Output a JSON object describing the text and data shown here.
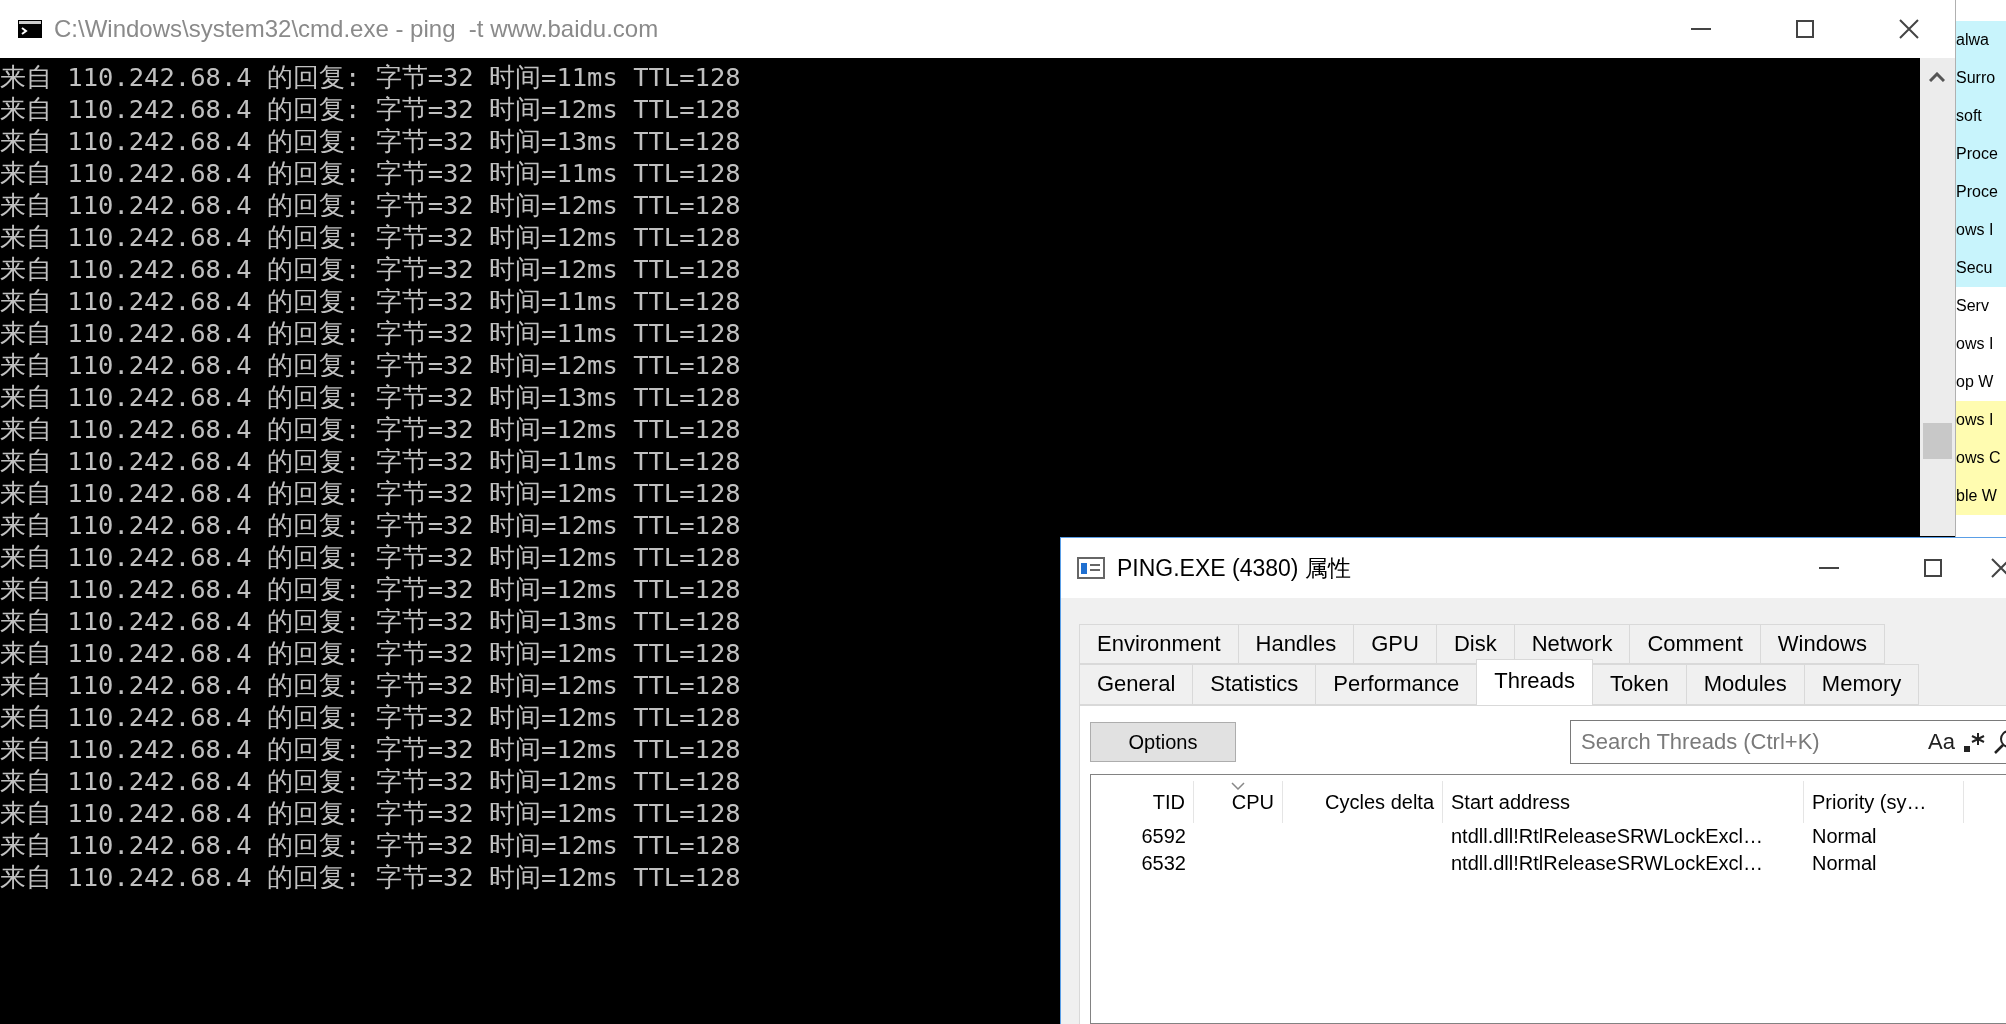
{
  "cmd_window": {
    "title": "C:\\Windows\\system32\\cmd.exe - ping  -t www.baidu.com",
    "lines": [
      "来自 110.242.68.4 的回复: 字节=32 时间=11ms TTL=128",
      "来自 110.242.68.4 的回复: 字节=32 时间=12ms TTL=128",
      "来自 110.242.68.4 的回复: 字节=32 时间=13ms TTL=128",
      "来自 110.242.68.4 的回复: 字节=32 时间=11ms TTL=128",
      "来自 110.242.68.4 的回复: 字节=32 时间=12ms TTL=128",
      "来自 110.242.68.4 的回复: 字节=32 时间=12ms TTL=128",
      "来自 110.242.68.4 的回复: 字节=32 时间=12ms TTL=128",
      "来自 110.242.68.4 的回复: 字节=32 时间=11ms TTL=128",
      "来自 110.242.68.4 的回复: 字节=32 时间=11ms TTL=128",
      "来自 110.242.68.4 的回复: 字节=32 时间=12ms TTL=128",
      "来自 110.242.68.4 的回复: 字节=32 时间=13ms TTL=128",
      "来自 110.242.68.4 的回复: 字节=32 时间=12ms TTL=128",
      "来自 110.242.68.4 的回复: 字节=32 时间=11ms TTL=128",
      "来自 110.242.68.4 的回复: 字节=32 时间=12ms TTL=128",
      "来自 110.242.68.4 的回复: 字节=32 时间=12ms TTL=128",
      "来自 110.242.68.4 的回复: 字节=32 时间=12ms TTL=128",
      "来自 110.242.68.4 的回复: 字节=32 时间=12ms TTL=128",
      "来自 110.242.68.4 的回复: 字节=32 时间=13ms TTL=128",
      "来自 110.242.68.4 的回复: 字节=32 时间=12ms TTL=128",
      "来自 110.242.68.4 的回复: 字节=32 时间=12ms TTL=128",
      "来自 110.242.68.4 的回复: 字节=32 时间=12ms TTL=128",
      "来自 110.242.68.4 的回复: 字节=32 时间=12ms TTL=128",
      "来自 110.242.68.4 的回复: 字节=32 时间=12ms TTL=128",
      "来自 110.242.68.4 的回复: 字节=32 时间=12ms TTL=128",
      "来自 110.242.68.4 的回复: 字节=32 时间=12ms TTL=128",
      "来自 110.242.68.4 的回复: 字节=32 时间=12ms TTL=128"
    ]
  },
  "background_list": {
    "rows": [
      {
        "text": "alwa",
        "color": "#c8f4fc"
      },
      {
        "text": "Surro",
        "color": "#c8f4fc"
      },
      {
        "text": "soft",
        "color": "#c8f4fc"
      },
      {
        "text": "Proce",
        "color": "#c8f4fc"
      },
      {
        "text": "Proce",
        "color": "#c8f4fc"
      },
      {
        "text": "ows I",
        "color": "#c8f4fc"
      },
      {
        "text": "Secu",
        "color": "#c8f4fc"
      },
      {
        "text": "Serv",
        "color": "#ffffff"
      },
      {
        "text": "ows I",
        "color": "#ffffff"
      },
      {
        "text": "op W",
        "color": "#ffffff"
      },
      {
        "text": "ows I",
        "color": "#fffcb0"
      },
      {
        "text": "ows C",
        "color": "#fffcb0"
      },
      {
        "text": "ble W",
        "color": "#fffcb0"
      }
    ]
  },
  "properties_window": {
    "title": "PING.EXE (4380) 属性",
    "tab_rows": [
      [
        {
          "label": "Environment",
          "selected": false
        },
        {
          "label": "Handles",
          "selected": false
        },
        {
          "label": "GPU",
          "selected": false
        },
        {
          "label": "Disk",
          "selected": false
        },
        {
          "label": "Network",
          "selected": false
        },
        {
          "label": "Comment",
          "selected": false
        },
        {
          "label": "Windows",
          "selected": false
        }
      ],
      [
        {
          "label": "General",
          "selected": false
        },
        {
          "label": "Statistics",
          "selected": false
        },
        {
          "label": "Performance",
          "selected": false
        },
        {
          "label": "Threads",
          "selected": true
        },
        {
          "label": "Token",
          "selected": false
        },
        {
          "label": "Modules",
          "selected": false
        },
        {
          "label": "Memory",
          "selected": false
        }
      ]
    ],
    "options_button": "Options",
    "search": {
      "placeholder": "Search Threads (Ctrl+K)",
      "case_toggle": "Aa"
    },
    "columns": [
      {
        "label": "TID",
        "sorted": false
      },
      {
        "label": "CPU",
        "sorted": true
      },
      {
        "label": "Cycles delta",
        "sorted": false
      },
      {
        "label": "Start address",
        "sorted": false
      },
      {
        "label": "Priority (sy…",
        "sorted": false
      }
    ],
    "rows": [
      {
        "tid": "6592",
        "start_address": "ntdll.dll!RtlReleaseSRWLockExcl…",
        "priority": "Normal"
      },
      {
        "tid": "6532",
        "start_address": "ntdll.dll!RtlReleaseSRWLockExcl…",
        "priority": "Normal"
      }
    ]
  }
}
